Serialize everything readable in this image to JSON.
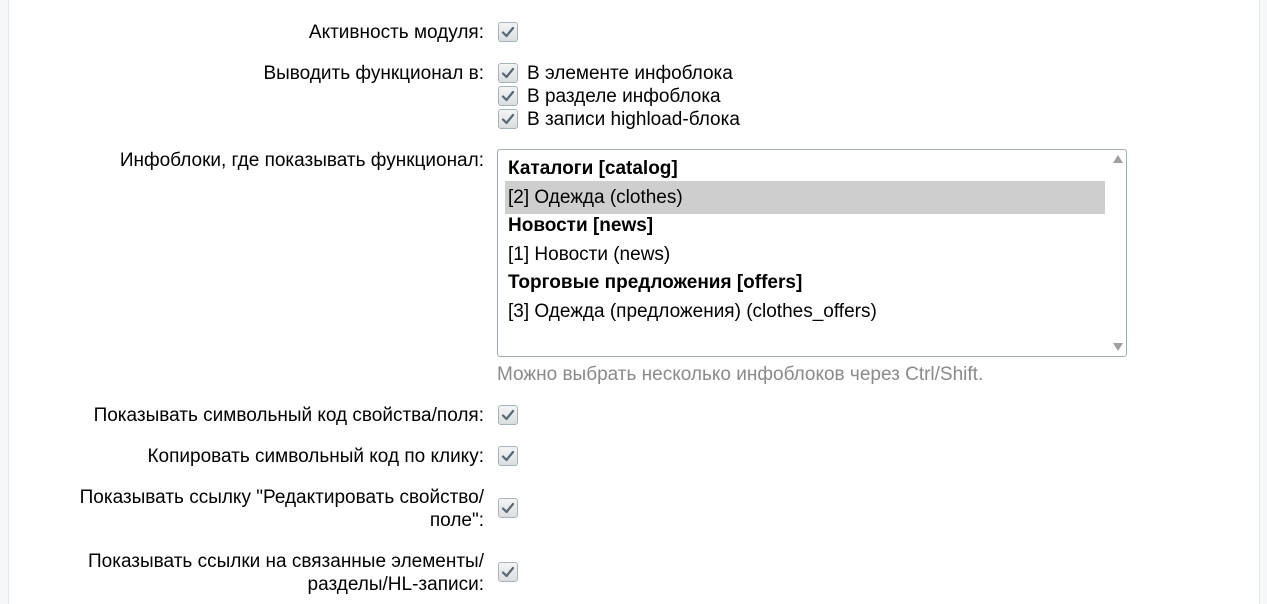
{
  "settings": {
    "module_active": {
      "label": "Активность модуля:",
      "checked": true
    },
    "display_in": {
      "label": "Выводить функционал в:",
      "options": [
        {
          "label": "В элементе инфоблока",
          "checked": true
        },
        {
          "label": "В разделе инфоблока",
          "checked": true
        },
        {
          "label": "В записи highload-блока",
          "checked": true
        }
      ]
    },
    "iblocks": {
      "label": "Инфоблоки, где показывать функционал:",
      "items": [
        {
          "text": "Каталоги [catalog]",
          "group": true,
          "selected": false
        },
        {
          "text": "[2] Одежда (clothes)",
          "group": false,
          "selected": true
        },
        {
          "text": "Новости [news]",
          "group": true,
          "selected": false
        },
        {
          "text": "[1] Новости (news)",
          "group": false,
          "selected": false
        },
        {
          "text": "Торговые предложения [offers]",
          "group": true,
          "selected": false
        },
        {
          "text": "[3] Одежда (предложения) (clothes_offers)",
          "group": false,
          "selected": false
        }
      ],
      "hint": "Можно выбрать несколько инфоблоков через Ctrl/Shift."
    },
    "show_code": {
      "label": "Показывать символьный код свойства/поля:",
      "checked": true
    },
    "copy_code": {
      "label": "Копировать символьный код по клику:",
      "checked": true
    },
    "edit_link": {
      "label_line1": "Показывать ссылку \"Редактировать свойство/",
      "label_line2": "поле\":",
      "checked": true
    },
    "related_links": {
      "label_line1": "Показывать ссылки на связанные элементы/",
      "label_line2": "разделы/HL-записи:",
      "checked": true
    }
  }
}
